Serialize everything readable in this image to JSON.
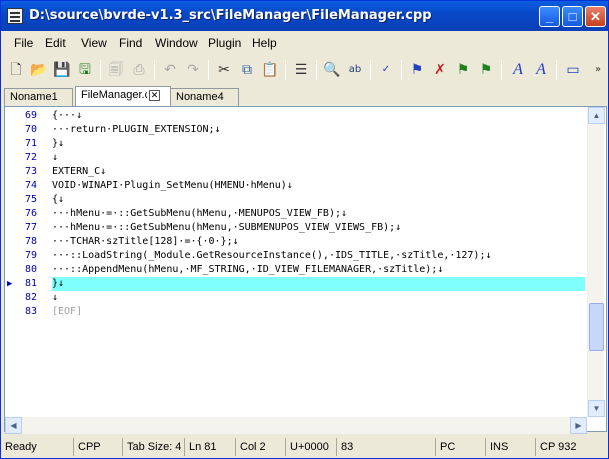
{
  "window": {
    "title": "D:\\source\\bvrde-v1.3_src\\FileManager\\FileManager.cpp"
  },
  "menu": [
    "File",
    "Edit",
    "View",
    "Find",
    "Window",
    "Plugin",
    "Help"
  ],
  "tabs": [
    {
      "label": "Noname1"
    },
    {
      "label": "FileManager.cpp"
    },
    {
      "label": "Noname4"
    }
  ],
  "code_lines": [
    {
      "n": "69",
      "text": "{···↓"
    },
    {
      "n": "70",
      "text": "···return·PLUGIN_EXTENSION;↓"
    },
    {
      "n": "71",
      "text": "}↓"
    },
    {
      "n": "72",
      "text": "↓"
    },
    {
      "n": "73",
      "text": "EXTERN_C↓"
    },
    {
      "n": "74",
      "text": "VOID·WINAPI·Plugin_SetMenu(HMENU·hMenu)↓"
    },
    {
      "n": "75",
      "text": "{↓"
    },
    {
      "n": "76",
      "text": "···hMenu·=·::GetSubMenu(hMenu,·MENUPOS_VIEW_FB);↓"
    },
    {
      "n": "77",
      "text": "···hMenu·=·::GetSubMenu(hMenu,·SUBMENUPOS_VIEW_VIEWS_FB);↓"
    },
    {
      "n": "78",
      "text": "···TCHAR·szTitle[128]·=·{·0·};↓"
    },
    {
      "n": "79",
      "text": "···::LoadString(_Module.GetResourceInstance(),·IDS_TITLE,·szTitle,·127);↓"
    },
    {
      "n": "80",
      "text": "···::AppendMenu(hMenu,·MF_STRING,·ID_VIEW_FILEMANAGER,·szTitle);↓"
    },
    {
      "n": "81",
      "text": "}↓"
    },
    {
      "n": "82",
      "text": "↓"
    },
    {
      "n": "83",
      "text": "[EOF]"
    }
  ],
  "status": {
    "state": "Ready",
    "lang": "CPP",
    "tab_size": "Tab Size: 4",
    "line": "Ln 81",
    "col": "Col 2",
    "unicode": "U+0000",
    "code": "83",
    "eol": "PC",
    "ins": "INS",
    "codepage": "CP 932"
  },
  "colors": {
    "highlight": "#80ffff",
    "linenum": "#0000b0",
    "keyword": "#0000ff",
    "function": "#c000c0"
  }
}
